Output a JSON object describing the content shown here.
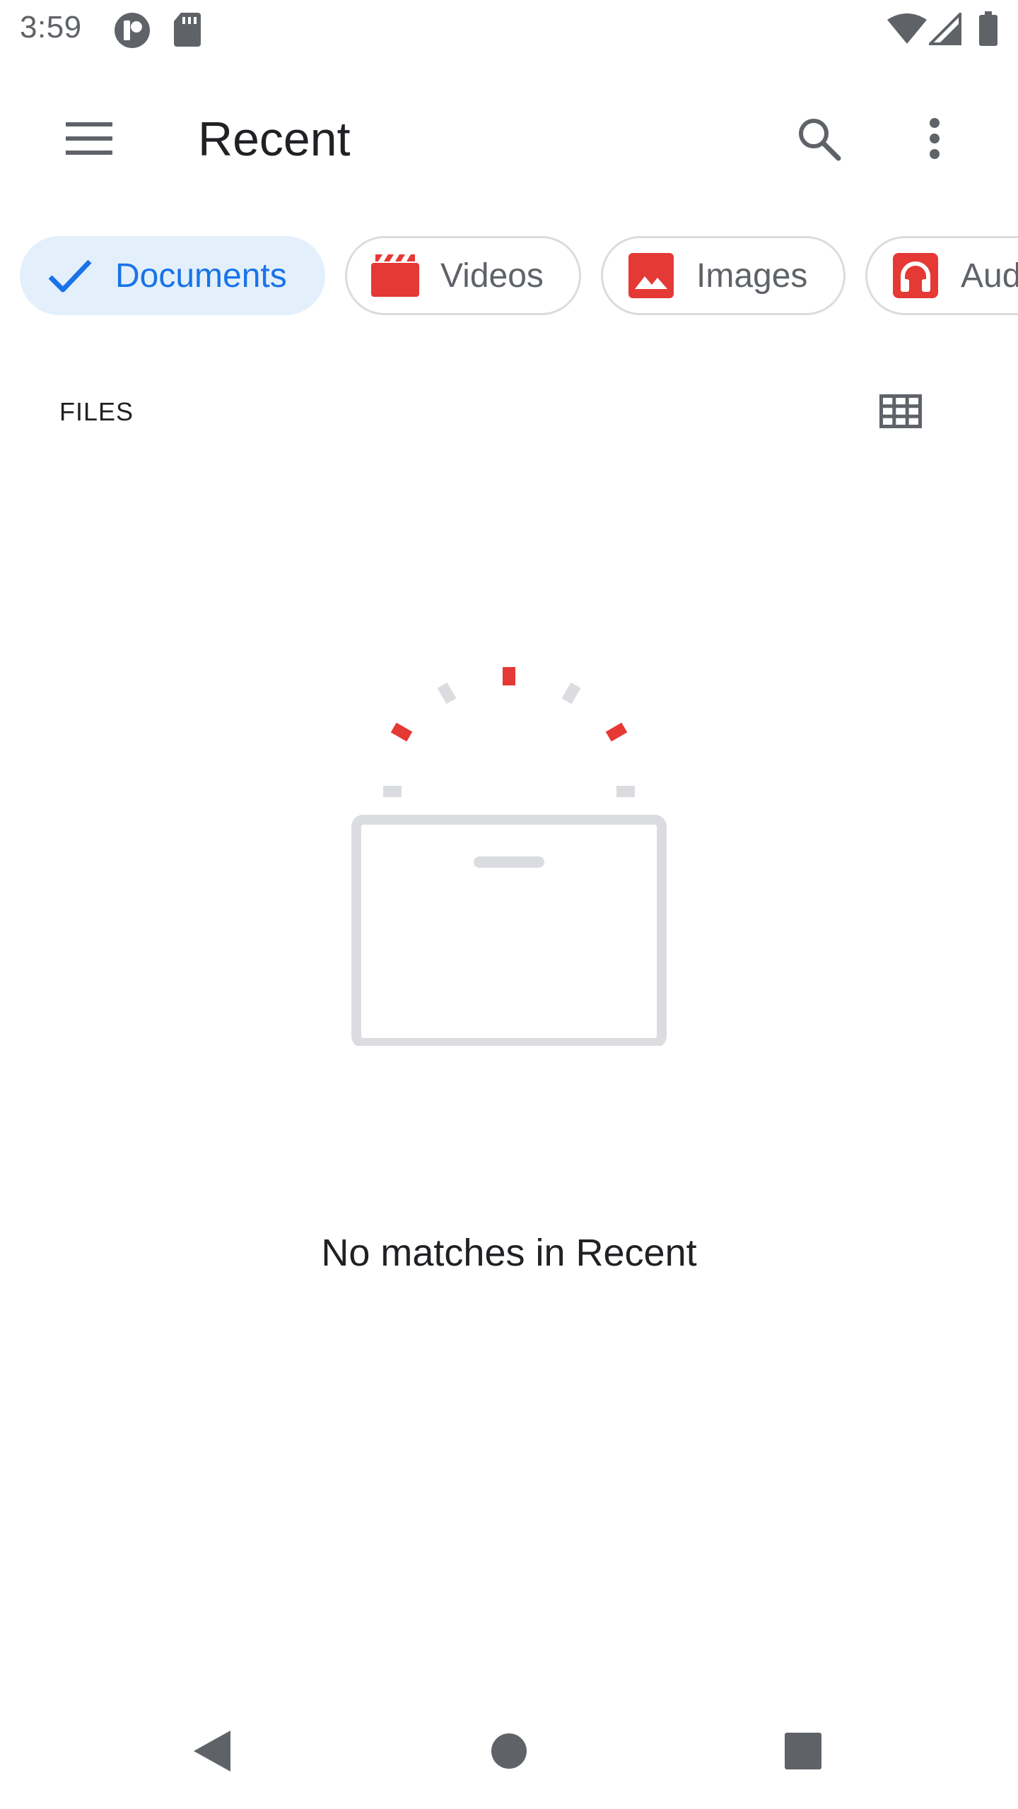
{
  "status_bar": {
    "time": "3:59",
    "icons": [
      "app-notification-icon",
      "sd-card-icon",
      "wifi-icon",
      "signal-icon",
      "battery-icon"
    ]
  },
  "app_bar": {
    "title": "Recent",
    "icons": [
      "menu-icon",
      "search-icon",
      "more-vert-icon"
    ]
  },
  "chips": [
    {
      "label": "Documents",
      "icon": "check-icon",
      "selected": true
    },
    {
      "label": "Videos",
      "icon": "video-icon",
      "selected": false
    },
    {
      "label": "Images",
      "icon": "image-icon",
      "selected": false
    },
    {
      "label": "Audio",
      "icon": "audio-icon",
      "selected": false
    }
  ],
  "section": {
    "label": "FILES",
    "view_toggle_icon": "grid-view-icon"
  },
  "empty_state": {
    "message": "No matches in Recent"
  },
  "nav_bar": {
    "icons": [
      "back-icon",
      "home-icon",
      "recents-icon"
    ]
  },
  "colors": {
    "accent": "#1a73e8",
    "chip_selected_bg": "#e3f0fc",
    "icon_red": "#e53935",
    "icon_grey": "#5f6368",
    "illustration_grey": "#dadce0"
  }
}
